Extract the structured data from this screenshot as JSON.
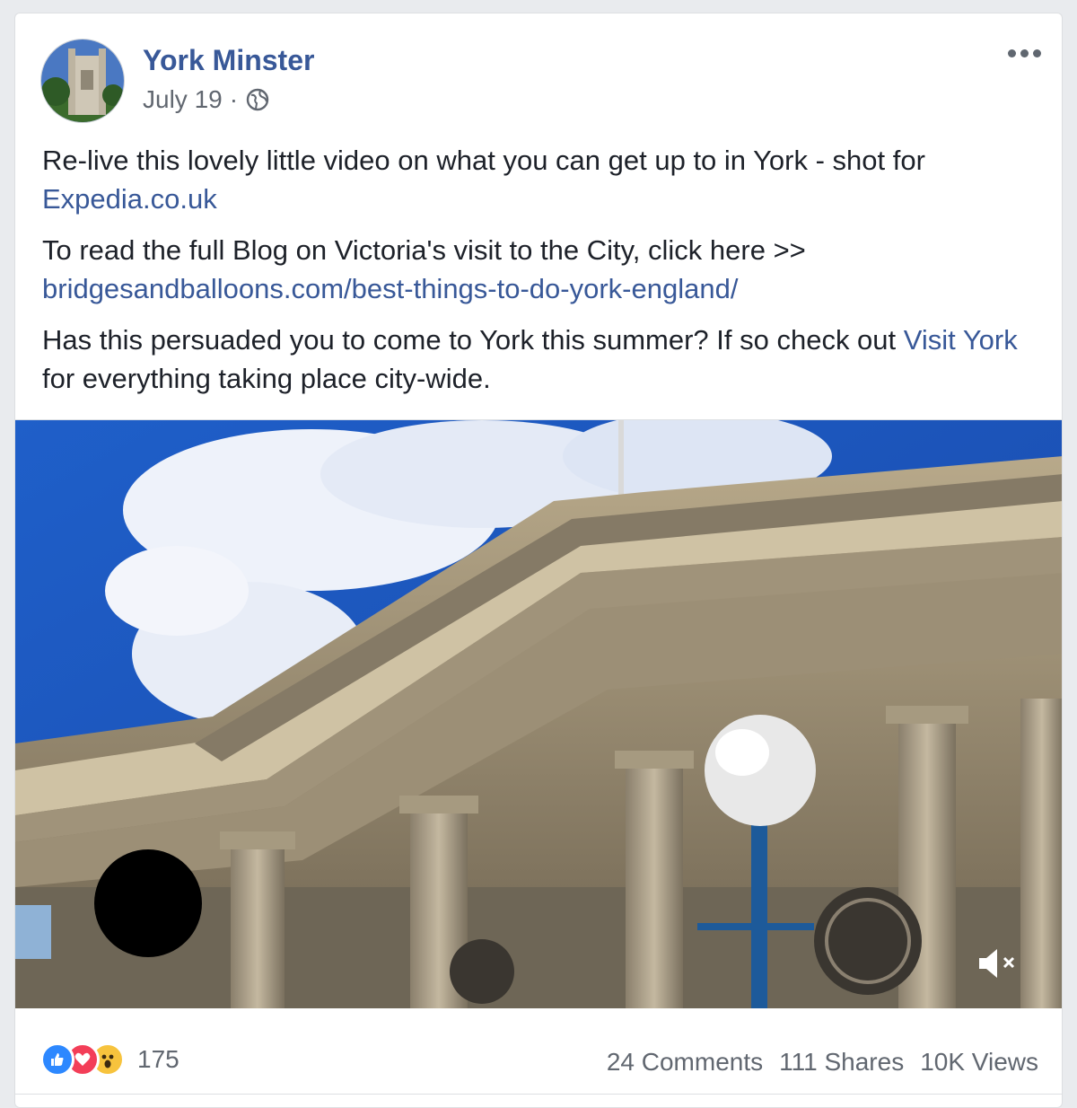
{
  "post": {
    "author": "York Minster",
    "date": "July 19",
    "separator": "·",
    "paragraphs": {
      "p1_text": "Re-live this lovely little video on what you can get up to in York - shot for ",
      "p1_link": "Expedia.co.uk",
      "p2_text": "To read the full Blog on Victoria's visit to the City, click here >> ",
      "p2_link": "bridgesandballoons.com/best-things-to-do-york-england/",
      "p3_text": "Has this persuaded you to come to York this summer? If so check out ",
      "p3_link": "Visit York",
      "p3_after": " for everything taking place city-wide."
    }
  },
  "reactions": {
    "icons": [
      "like-icon",
      "love-icon",
      "wow-icon"
    ],
    "count": "175"
  },
  "stats": {
    "comments": "24 Comments",
    "shares": "111 Shares",
    "views": "10K Views"
  },
  "colors": {
    "link": "#385898",
    "like": "#2d88ff",
    "love": "#f33e58",
    "wow": "#f7c33d"
  }
}
